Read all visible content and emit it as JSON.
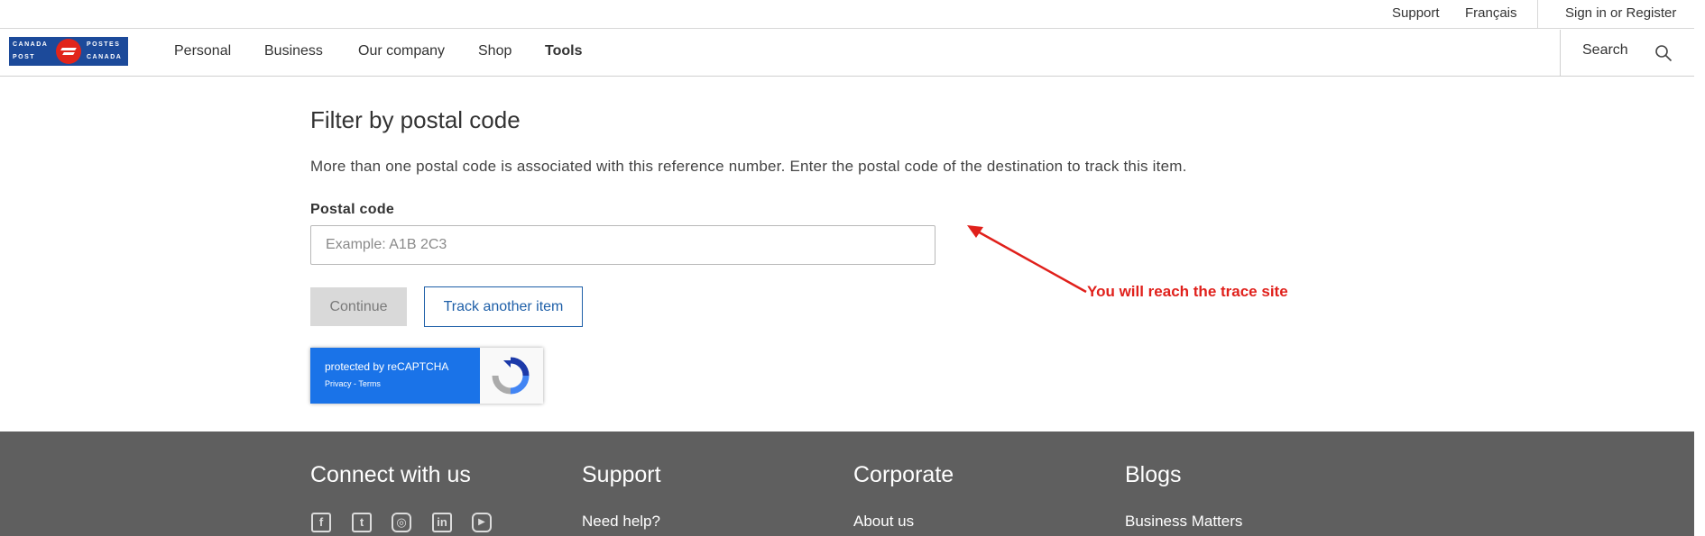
{
  "utility": {
    "support": "Support",
    "language": "Français",
    "signin": "Sign in or Register"
  },
  "logo": {
    "top_left": "CANADA",
    "bottom_left": "POST",
    "top_right": "POSTES",
    "bottom_right": "CANADA"
  },
  "nav": {
    "items": [
      "Personal",
      "Business",
      "Our company",
      "Shop",
      "Tools"
    ],
    "active": "Tools",
    "search_label": "Search",
    "search_icon": "search-icon"
  },
  "content": {
    "title": "Filter by postal code",
    "intro": "More than one postal code is associated with this reference number. Enter the postal code of the destination to track this item.",
    "field_label": "Postal code",
    "field_placeholder": "Example: A1B 2C3",
    "field_value": "",
    "continue_label": "Continue",
    "track_label": "Track another item"
  },
  "recaptcha": {
    "line1": "protected by reCAPTCHA",
    "line2": "Privacy - Terms"
  },
  "annotation": {
    "text": "You will reach the trace site",
    "color": "#e0201b"
  },
  "footer": {
    "columns": [
      {
        "heading": "Connect with us"
      },
      {
        "heading": "Support",
        "link": "Need help?"
      },
      {
        "heading": "Corporate",
        "link": "About us"
      },
      {
        "heading": "Blogs",
        "link": "Business Matters"
      }
    ],
    "social_icons": [
      "facebook-icon",
      "twitter-icon",
      "instagram-icon",
      "linkedin-icon",
      "youtube-icon"
    ]
  },
  "colors": {
    "brand_blue": "#1c4a9a",
    "brand_red": "#e1251b",
    "link_blue": "#1e5fa8",
    "footer_bg": "#5f5f5f"
  }
}
